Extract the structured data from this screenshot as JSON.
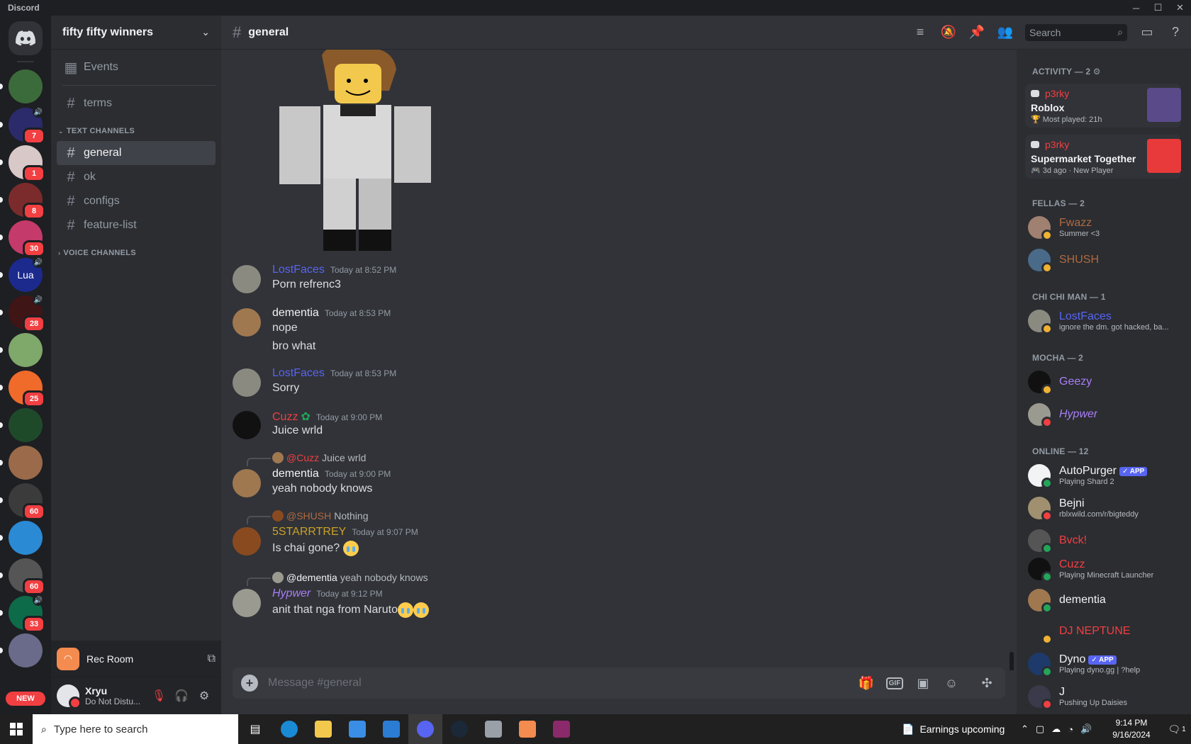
{
  "window": {
    "title": "Discord",
    "controls": [
      "─",
      "☐",
      "✕"
    ]
  },
  "rail": {
    "servers": [
      {
        "color": "#3b6b3a",
        "badge": "",
        "speaker": false
      },
      {
        "color": "#2b2a6b",
        "badge": "7",
        "speaker": true
      },
      {
        "color": "#d9c8c8",
        "badge": "1",
        "speaker": false
      },
      {
        "color": "#7b2b2b",
        "badge": "8",
        "speaker": false
      },
      {
        "color": "#c43a6a",
        "badge": "30",
        "speaker": false
      },
      {
        "color": "#1b2a8c",
        "badge": "",
        "speaker": true,
        "label": "Lua"
      },
      {
        "color": "#401515",
        "badge": "28",
        "speaker": true
      },
      {
        "color": "#7fa86b",
        "badge": "",
        "speaker": false
      },
      {
        "color": "#f06a2a",
        "badge": "25",
        "speaker": false
      },
      {
        "color": "#1f4a2a",
        "badge": "",
        "speaker": false
      },
      {
        "color": "#9a6a4a",
        "badge": "",
        "speaker": false
      },
      {
        "color": "#3b3b3b",
        "badge": "60",
        "speaker": false
      },
      {
        "color": "#2a8ad4",
        "badge": "",
        "speaker": false
      },
      {
        "color": "#555555",
        "badge": "60",
        "speaker": false
      },
      {
        "color": "#0d6b4a",
        "badge": "33",
        "speaker": true
      },
      {
        "color": "#6a6a8a",
        "badge": "",
        "speaker": false
      }
    ],
    "new_label": "NEW"
  },
  "sidebar": {
    "guild_name": "fifty fifty winners",
    "events_label": "Events",
    "top_channels": [
      {
        "name": "terms"
      }
    ],
    "text_category": "TEXT CHANNELS",
    "text_channels": [
      {
        "name": "general",
        "active": true
      },
      {
        "name": "ok",
        "active": false
      },
      {
        "name": "configs",
        "active": false
      },
      {
        "name": "feature-list",
        "active": false
      }
    ],
    "voice_category": "VOICE CHANNELS",
    "activity": {
      "name": "Rec Room"
    },
    "user": {
      "name": "Xryu",
      "status": "Do Not Distu..."
    }
  },
  "chat": {
    "channel": "general",
    "search_placeholder": "Search",
    "composer_placeholder": "Message #general",
    "messages": [
      {
        "author": "LostFaces",
        "color": "#5865f2",
        "time": "Today at 8:52 PM",
        "lines": [
          "Porn refrenc3"
        ],
        "avatar": "#8a8a80"
      },
      {
        "author": "dementia",
        "color": "#f2f3f5",
        "time": "Today at 8:53 PM",
        "lines": [
          "nope",
          "bro what"
        ],
        "avatar": "#a07850"
      },
      {
        "author": "LostFaces",
        "color": "#5865f2",
        "time": "Today at 8:53 PM",
        "lines": [
          "Sorry"
        ],
        "avatar": "#8a8a80"
      },
      {
        "author": "Cuzz",
        "color": "#f23f42",
        "time": "Today at 9:00 PM",
        "lines": [
          "Juice wrld"
        ],
        "avatar": "#111111"
      },
      {
        "author": "dementia",
        "color": "#f2f3f5",
        "time": "Today at 9:00 PM",
        "lines": [
          "yeah nobody knows"
        ],
        "avatar": "#a07850",
        "reply_to": "@Cuzz",
        "reply_color": "#f23f42",
        "reply_text": "Juice wrld"
      },
      {
        "author": "5STARRTREY",
        "color": "#c9a227",
        "time": "Today at 9:07 PM",
        "lines": [
          "Is chai gone?"
        ],
        "avatar": "#8a4a20",
        "reply_to": "@SHUSH",
        "reply_color": "#b06a40",
        "reply_text": "Nothing"
      },
      {
        "author": "Hypwer",
        "color": "#a97ef5",
        "time": "Today at 9:12 PM",
        "lines": [
          "anit that nga from Naruto"
        ],
        "avatar": "#9a9a90",
        "reply_to": "@dementia",
        "reply_color": "#f2f3f5",
        "reply_text": "yeah nobody knows"
      }
    ]
  },
  "members": {
    "activity_title": "ACTIVITY — 2",
    "activities": [
      {
        "user": "p3rky",
        "game": "Roblox",
        "meta": "🏆 Most played: 21h",
        "thumb": "#5a4a8a"
      },
      {
        "user": "p3rky",
        "game": "Supermarket Together",
        "meta": "🎮 3d ago · New Player",
        "thumb": "#e83a3a"
      }
    ],
    "groups": [
      {
        "title": "FELLAS — 2",
        "members": [
          {
            "name": "Fwazz",
            "color": "#b06a40",
            "sub": "Summer <3",
            "status": "#f0b232",
            "avatar": "#a08070"
          },
          {
            "name": "SHUSH",
            "color": "#b06a40",
            "sub": "",
            "status": "#f0b232",
            "avatar": "#4a6a8a"
          }
        ]
      },
      {
        "title": "CHI CHI MAN — 1",
        "members": [
          {
            "name": "LostFaces",
            "color": "#5865f2",
            "sub": "ignore the dm. got hacked, ba...",
            "status": "#f0b232",
            "avatar": "#8a8a80"
          }
        ]
      },
      {
        "title": "MOCHA — 2",
        "members": [
          {
            "name": "Geezy",
            "color": "#a97ef5",
            "sub": "",
            "status": "#f0b232",
            "avatar": "#111111"
          },
          {
            "name": "Hypwer",
            "color": "#a97ef5",
            "sub": "",
            "status": "#f23f42",
            "avatar": "#9a9a90"
          }
        ]
      },
      {
        "title": "ONLINE — 12",
        "members": [
          {
            "name": "AutoPurger",
            "color": "#f2f3f5",
            "sub": "Playing Shard 2",
            "status": "#23a55a",
            "avatar": "#f2f3f5",
            "app": "✓ APP"
          },
          {
            "name": "Bejni",
            "color": "#f2f3f5",
            "sub": "rblxwild.com/r/bigteddy",
            "status": "#f23f42",
            "avatar": "#a09070"
          },
          {
            "name": "Bvck!",
            "color": "#f23f42",
            "sub": "",
            "status": "#23a55a",
            "avatar": "#555555"
          },
          {
            "name": "Cuzz",
            "color": "#f23f42",
            "sub": "Playing Minecraft Launcher",
            "status": "#23a55a",
            "avatar": "#111111"
          },
          {
            "name": "dementia",
            "color": "#f2f3f5",
            "sub": "",
            "status": "#23a55a",
            "avatar": "#a07850"
          },
          {
            "name": "DJ NEPTUNE",
            "color": "#f23f42",
            "sub": "",
            "status": "#f0b232",
            "avatar": "#2b2d31"
          },
          {
            "name": "Dyno",
            "color": "#f2f3f5",
            "sub": "Playing dyno.gg | ?help",
            "status": "#23a55a",
            "avatar": "#1e3a6a",
            "app": "✓ APP"
          },
          {
            "name": "J",
            "color": "#f2f3f5",
            "sub": "Pushing Up Daisies",
            "status": "#f23f42",
            "avatar": "#3a3a4a"
          }
        ]
      }
    ]
  },
  "taskbar": {
    "search_placeholder": "Type here to search",
    "weather": "Earnings upcoming",
    "time": "9:14 PM",
    "date": "9/16/2024",
    "notif_count": "1"
  }
}
